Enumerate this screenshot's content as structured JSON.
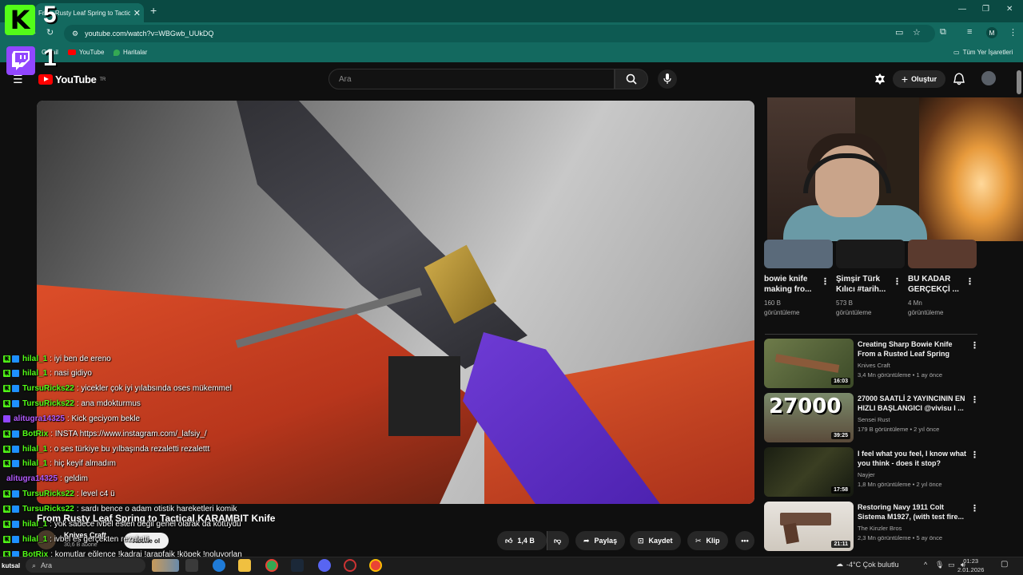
{
  "browser": {
    "tab_title": "From Rusty Leaf Spring to Tactic",
    "url": "youtube.com/watch?v=WBGwb_UUkDQ",
    "profile_initial": "M",
    "bookmarks": [
      {
        "label": "Gmail"
      },
      {
        "label": "YouTube"
      },
      {
        "label": "Haritalar"
      }
    ],
    "all_bookmarks_label": "Tüm Yer İşaretleri"
  },
  "stream_overlay": {
    "kick_count": "5",
    "twitch_count": "1"
  },
  "youtube": {
    "logo_text": "YouTube",
    "region": "TR",
    "search_placeholder": "Ara",
    "create_label": "Oluştur",
    "video_title": "From Rusty Leaf Spring to Tactical KARAMBIT Knife",
    "channel_name": "Knives Craft",
    "subscriber_count": "30,6 B abone",
    "subscribe_label": "Abone ol",
    "actions": {
      "like_count": "1,4 B",
      "share_label": "Paylaş",
      "save_label": "Kaydet",
      "clip_label": "Klip"
    }
  },
  "shorts": [
    {
      "title_line1": "bowie knife",
      "title_line2": "making fro...",
      "views": "160 B",
      "views_suffix": "görüntüleme"
    },
    {
      "title_line1": "Şimşir Türk",
      "title_line2": "Kılıcı #tarih...",
      "views": "573 B",
      "views_suffix": "görüntüleme"
    },
    {
      "title_line1": "BU KADAR",
      "title_line2": "GERÇEKÇİ ...",
      "views": "4 Mn",
      "views_suffix": "görüntüleme"
    }
  ],
  "recommendations": [
    {
      "title_line1": "Creating Sharp Bowie Knife",
      "title_line2": "From a Rusted Leaf Spring",
      "channel": "Knives Craft",
      "meta": "3,4 Mn görüntüleme • 1 ay önce",
      "duration": "16:03"
    },
    {
      "title_line1": "27000 SAATLİ 2 YAYINCININ EN",
      "title_line2": "HIZLI BAŞLANGICI @vivisu  I ...",
      "channel": "Sensei Rust",
      "meta": "179 B görüntüleme • 2 yıl önce",
      "duration": "39:25",
      "thumb_text": "27000"
    },
    {
      "title_line1": "I feel what you feel, I know what",
      "title_line2": "you think - does it stop?",
      "channel": "Nayjer",
      "meta": "1,8 Mn görüntüleme • 2 yıl önce",
      "duration": "17:58"
    },
    {
      "title_line1": "Restoring Navy 1911 Colt",
      "title_line2": "Sistema M1927, (with test fire...",
      "channel": "The Kinzler Bros",
      "meta": "2,3 Mn görüntüleme • 5 ay önce",
      "duration": "21:11"
    }
  ],
  "chat": [
    {
      "user": "hilal_1",
      "color": "#53fc18",
      "message": ": iyi ben de ereno",
      "platform": "kick"
    },
    {
      "user": "hilal_1",
      "color": "#53fc18",
      "message": ": nasi gidiyo",
      "platform": "kick"
    },
    {
      "user": "TursuRicks22",
      "color": "#53fc18",
      "message": ": yicekler çok iyi yılabsında oses mükemmel",
      "platform": "kick"
    },
    {
      "user": "TursuRicks22",
      "color": "#53fc18",
      "message": ": ana mdokturmus",
      "platform": "kick"
    },
    {
      "user": "alitugra14325",
      "color": "#b45cff",
      "message": ": Kick geciyom bekle",
      "platform": "twitch"
    },
    {
      "user": "BotRix",
      "color": "#53fc18",
      "message": ": INSTA https://www.instagram.com/_lafsiy_/",
      "platform": "kick-bot"
    },
    {
      "user": "hilal_1",
      "color": "#53fc18",
      "message": ": o ses türkiye bu yılbaşında rezaletti rezalettt",
      "platform": "kick"
    },
    {
      "user": "hilal_1",
      "color": "#53fc18",
      "message": ": hiç keyif almadım",
      "platform": "kick"
    },
    {
      "user": "alitugra14325",
      "color": "#b45cff",
      "message": ": geldim",
      "platform": "twitch-plain"
    },
    {
      "user": "TursuRicks22",
      "color": "#53fc18",
      "message": ": level c4 ü",
      "platform": "kick"
    },
    {
      "user": "TursuRicks22",
      "color": "#53fc18",
      "message": ": sardı bence o adam otistik hareketleri komik",
      "platform": "kick"
    },
    {
      "user": "hilal_1",
      "color": "#53fc18",
      "message": ": yok sadece ivbel esten değil genel olarak da kötüydü",
      "platform": "kick"
    },
    {
      "user": "hilal_1",
      "color": "#53fc18",
      "message": ": ivbel es gerçekten rezaletti",
      "platform": "kick"
    },
    {
      "user": "BotRix",
      "color": "#53fc18",
      "message": ": komutlar eğlence !kadraj !arapfaik !köpek !noluyorlan",
      "platform": "kick-bot"
    }
  ],
  "taskbar": {
    "left_label": "kutsal",
    "search_placeholder": "Ara",
    "weather": "-4°C  Çok bulutlu",
    "time": "01:23",
    "date": "2.01.2026"
  }
}
